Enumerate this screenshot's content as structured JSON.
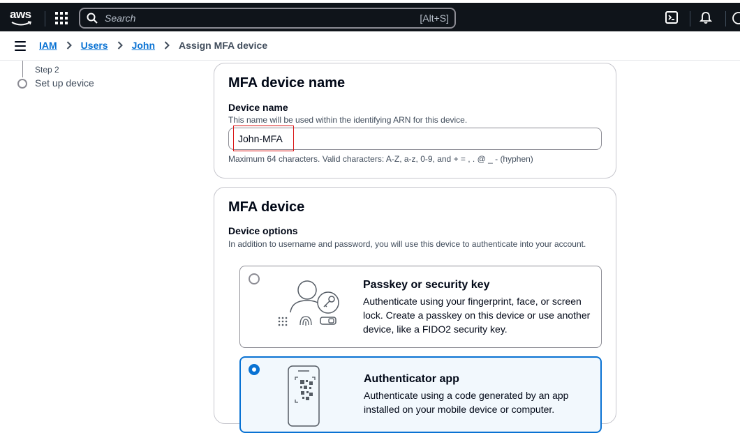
{
  "topbar": {
    "logo_text": "aws",
    "search_placeholder": "Search",
    "search_shortcut": "[Alt+S]"
  },
  "breadcrumbs": {
    "items": [
      "IAM",
      "Users",
      "John"
    ],
    "current": "Assign MFA device"
  },
  "steps": {
    "step_label": "Step 2",
    "step_title": "Set up device"
  },
  "device_name_panel": {
    "heading": "MFA device name",
    "label": "Device name",
    "description": "This name will be used within the identifying ARN for this device.",
    "value": "John-MFA",
    "constraint": "Maximum 64 characters. Valid characters: A-Z, a-z, 0-9, and + = , . @ _ - (hyphen)"
  },
  "mfa_device_panel": {
    "heading": "MFA device",
    "label": "Device options",
    "description": "In addition to username and password, you will use this device to authenticate into your account.",
    "options": [
      {
        "title": "Passkey or security key",
        "description": "Authenticate using your fingerprint, face, or screen lock. Create a passkey on this device or use another device, like a FIDO2 security key.",
        "selected": false
      },
      {
        "title": "Authenticator app",
        "description": "Authenticate using a code generated by an app installed on your mobile device or computer.",
        "selected": true
      }
    ]
  },
  "colors": {
    "accent": "#0972d3",
    "nav_bg": "#0f141a",
    "highlight_box": "#d91515"
  }
}
